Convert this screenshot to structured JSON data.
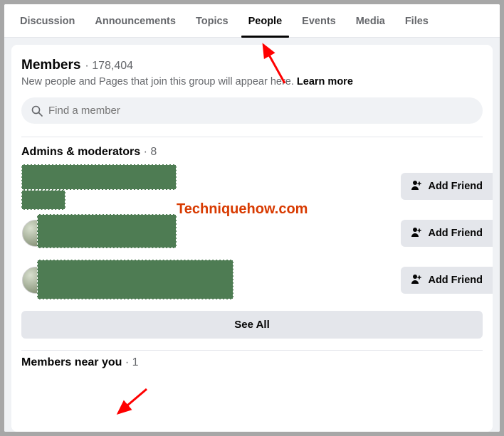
{
  "tabs": [
    {
      "label": "Discussion"
    },
    {
      "label": "Announcements"
    },
    {
      "label": "Topics"
    },
    {
      "label": "People",
      "active": true
    },
    {
      "label": "Events"
    },
    {
      "label": "Media"
    },
    {
      "label": "Files"
    }
  ],
  "members": {
    "title": "Members",
    "count": "178,404",
    "subtext": "New people and Pages that join this group will appear here.",
    "learn_more": "Learn more",
    "search_placeholder": "Find a member"
  },
  "admins": {
    "title": "Admins & moderators",
    "count": "8",
    "add_friend_label": "Add Friend",
    "see_all_label": "See All"
  },
  "near": {
    "title": "Members near you",
    "count": "1"
  },
  "watermark": "Techniquehow.com"
}
